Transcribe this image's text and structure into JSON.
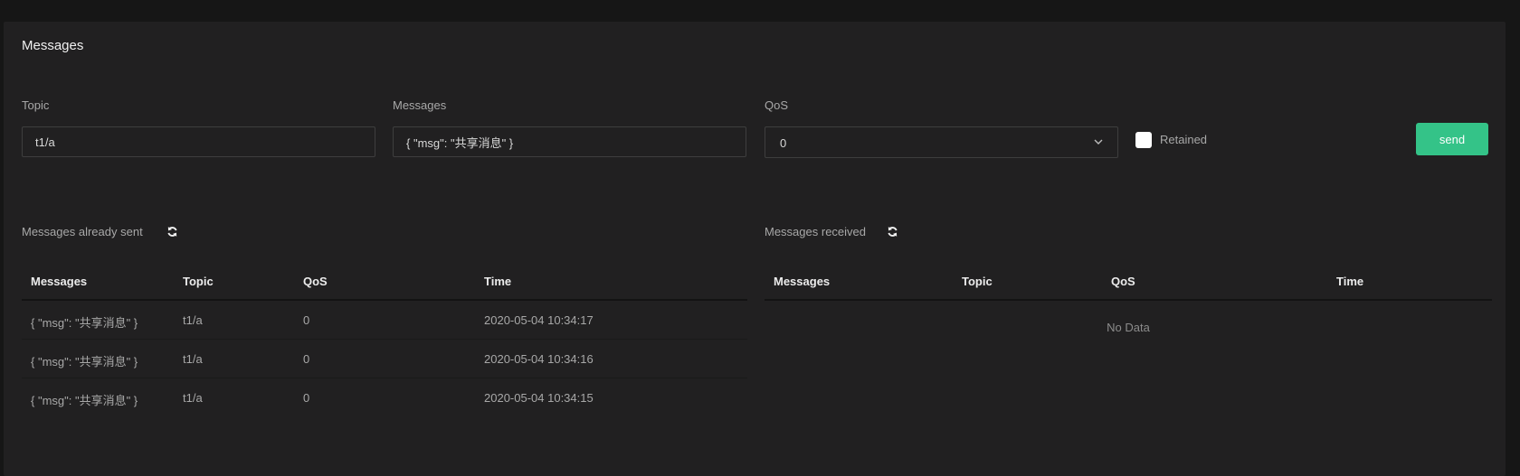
{
  "panel": {
    "title": "Messages"
  },
  "form": {
    "topic_label": "Topic",
    "topic_value": "t1/a",
    "messages_label": "Messages",
    "messages_value": "{ \"msg\": \"共享消息\" }",
    "qos_label": "QoS",
    "qos_value": "0",
    "retained_label": "Retained",
    "retained_checked": false,
    "send_label": "send"
  },
  "sent": {
    "title": "Messages already sent",
    "columns": [
      "Messages",
      "Topic",
      "QoS",
      "Time"
    ],
    "rows": [
      {
        "message": "{ \"msg\": \"共享消息\" }",
        "topic": "t1/a",
        "qos": "0",
        "time": "2020-05-04 10:34:17"
      },
      {
        "message": "{ \"msg\": \"共享消息\" }",
        "topic": "t1/a",
        "qos": "0",
        "time": "2020-05-04 10:34:16"
      },
      {
        "message": "{ \"msg\": \"共享消息\" }",
        "topic": "t1/a",
        "qos": "0",
        "time": "2020-05-04 10:34:15"
      }
    ]
  },
  "received": {
    "title": "Messages received",
    "columns": [
      "Messages",
      "Topic",
      "QoS",
      "Time"
    ],
    "empty_text": "No Data"
  },
  "colors": {
    "background": "#212021",
    "accent": "#34c388",
    "text": "#a8a8a8"
  }
}
